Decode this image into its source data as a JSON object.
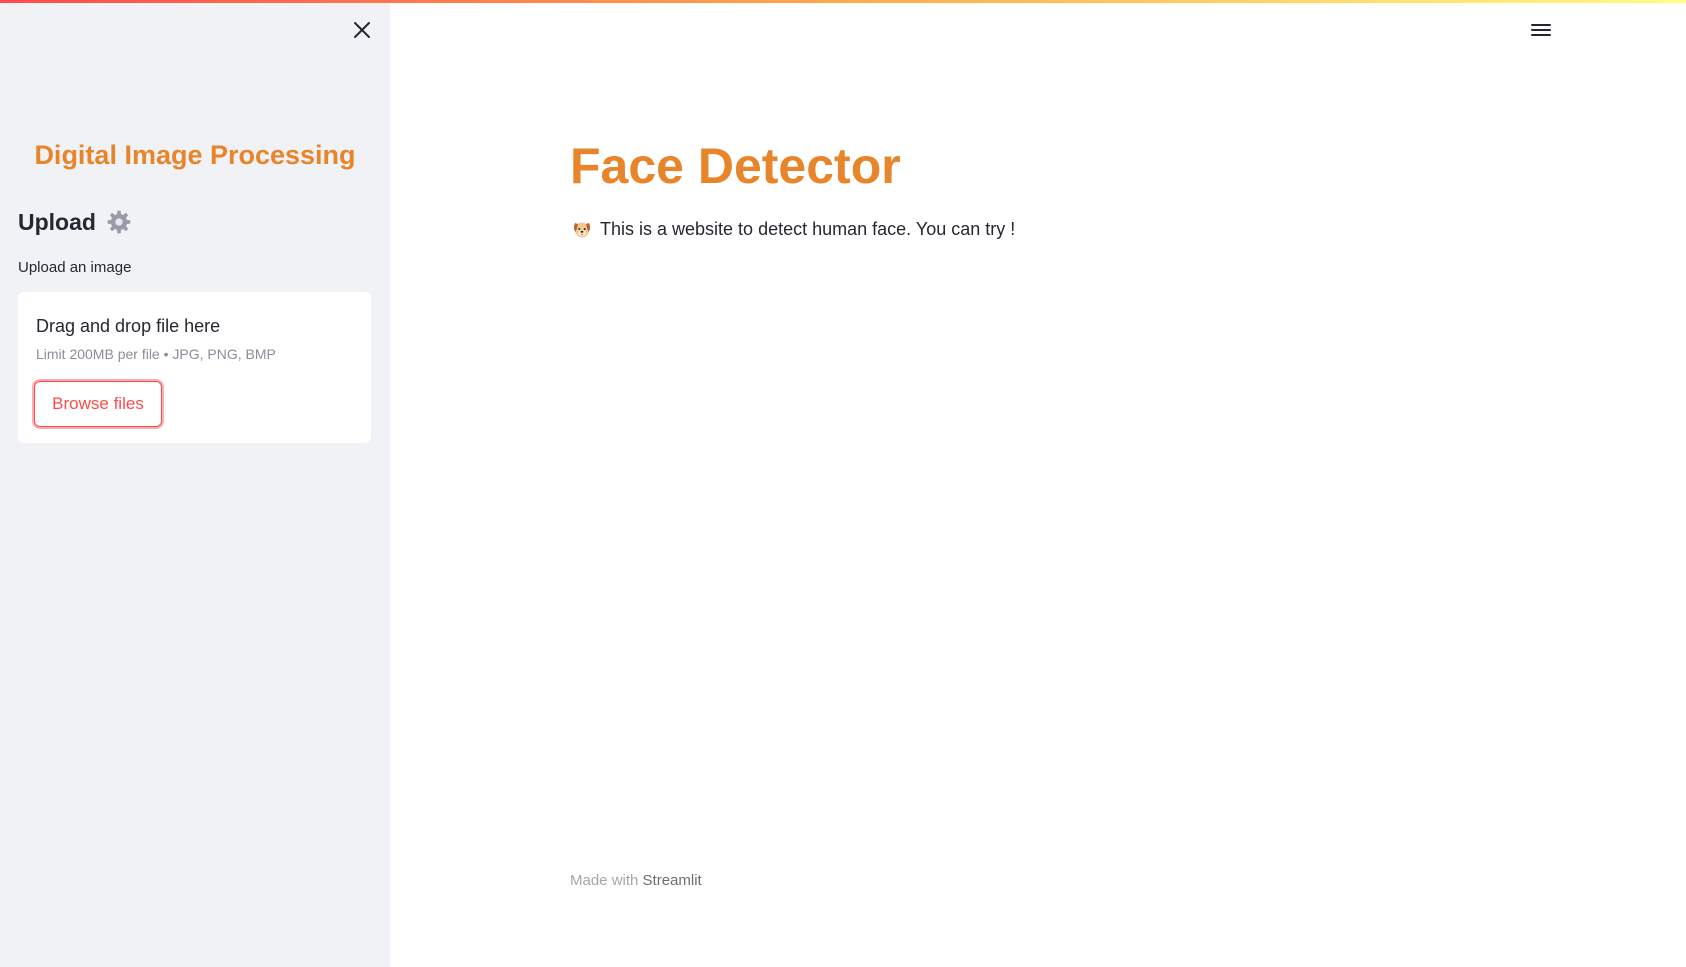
{
  "colors": {
    "accent": "#e8852a",
    "primary": "#ff4b4b",
    "sidebar_bg": "#f0f2f6",
    "text": "#262730"
  },
  "sidebar": {
    "close_icon": "close-icon",
    "title": "Digital Image Processing",
    "upload_heading": "Upload",
    "upload_heading_icon": "gear-icon",
    "uploader": {
      "label": "Upload an image",
      "drop_text": "Drag and drop file here",
      "limit_text": "Limit 200MB per file • JPG, PNG, BMP",
      "browse_label": "Browse files"
    }
  },
  "header": {
    "menu_icon": "hamburger-menu-icon"
  },
  "main": {
    "title": "Face Detector",
    "description_icon": "dog-face-icon",
    "description": "This is a website to detect human face. You can try !"
  },
  "footer": {
    "prefix": "Made with",
    "link": "Streamlit"
  }
}
